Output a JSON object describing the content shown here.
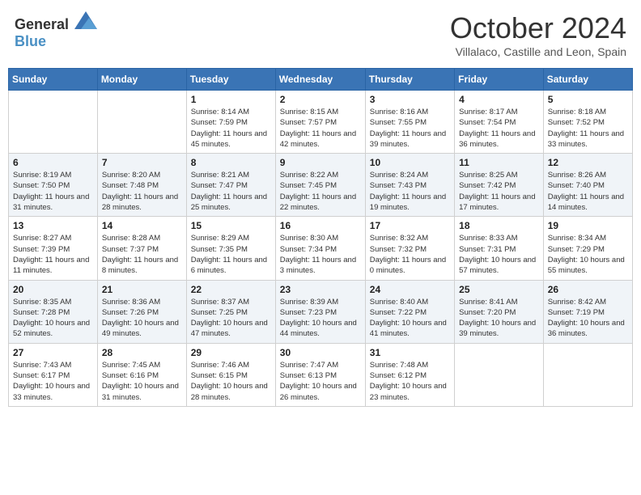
{
  "header": {
    "logo_general": "General",
    "logo_blue": "Blue",
    "month": "October 2024",
    "location": "Villalaco, Castille and Leon, Spain"
  },
  "weekdays": [
    "Sunday",
    "Monday",
    "Tuesday",
    "Wednesday",
    "Thursday",
    "Friday",
    "Saturday"
  ],
  "weeks": [
    [
      {
        "day": "",
        "info": ""
      },
      {
        "day": "",
        "info": ""
      },
      {
        "day": "1",
        "info": "Sunrise: 8:14 AM\nSunset: 7:59 PM\nDaylight: 11 hours and 45 minutes."
      },
      {
        "day": "2",
        "info": "Sunrise: 8:15 AM\nSunset: 7:57 PM\nDaylight: 11 hours and 42 minutes."
      },
      {
        "day": "3",
        "info": "Sunrise: 8:16 AM\nSunset: 7:55 PM\nDaylight: 11 hours and 39 minutes."
      },
      {
        "day": "4",
        "info": "Sunrise: 8:17 AM\nSunset: 7:54 PM\nDaylight: 11 hours and 36 minutes."
      },
      {
        "day": "5",
        "info": "Sunrise: 8:18 AM\nSunset: 7:52 PM\nDaylight: 11 hours and 33 minutes."
      }
    ],
    [
      {
        "day": "6",
        "info": "Sunrise: 8:19 AM\nSunset: 7:50 PM\nDaylight: 11 hours and 31 minutes."
      },
      {
        "day": "7",
        "info": "Sunrise: 8:20 AM\nSunset: 7:48 PM\nDaylight: 11 hours and 28 minutes."
      },
      {
        "day": "8",
        "info": "Sunrise: 8:21 AM\nSunset: 7:47 PM\nDaylight: 11 hours and 25 minutes."
      },
      {
        "day": "9",
        "info": "Sunrise: 8:22 AM\nSunset: 7:45 PM\nDaylight: 11 hours and 22 minutes."
      },
      {
        "day": "10",
        "info": "Sunrise: 8:24 AM\nSunset: 7:43 PM\nDaylight: 11 hours and 19 minutes."
      },
      {
        "day": "11",
        "info": "Sunrise: 8:25 AM\nSunset: 7:42 PM\nDaylight: 11 hours and 17 minutes."
      },
      {
        "day": "12",
        "info": "Sunrise: 8:26 AM\nSunset: 7:40 PM\nDaylight: 11 hours and 14 minutes."
      }
    ],
    [
      {
        "day": "13",
        "info": "Sunrise: 8:27 AM\nSunset: 7:39 PM\nDaylight: 11 hours and 11 minutes."
      },
      {
        "day": "14",
        "info": "Sunrise: 8:28 AM\nSunset: 7:37 PM\nDaylight: 11 hours and 8 minutes."
      },
      {
        "day": "15",
        "info": "Sunrise: 8:29 AM\nSunset: 7:35 PM\nDaylight: 11 hours and 6 minutes."
      },
      {
        "day": "16",
        "info": "Sunrise: 8:30 AM\nSunset: 7:34 PM\nDaylight: 11 hours and 3 minutes."
      },
      {
        "day": "17",
        "info": "Sunrise: 8:32 AM\nSunset: 7:32 PM\nDaylight: 11 hours and 0 minutes."
      },
      {
        "day": "18",
        "info": "Sunrise: 8:33 AM\nSunset: 7:31 PM\nDaylight: 10 hours and 57 minutes."
      },
      {
        "day": "19",
        "info": "Sunrise: 8:34 AM\nSunset: 7:29 PM\nDaylight: 10 hours and 55 minutes."
      }
    ],
    [
      {
        "day": "20",
        "info": "Sunrise: 8:35 AM\nSunset: 7:28 PM\nDaylight: 10 hours and 52 minutes."
      },
      {
        "day": "21",
        "info": "Sunrise: 8:36 AM\nSunset: 7:26 PM\nDaylight: 10 hours and 49 minutes."
      },
      {
        "day": "22",
        "info": "Sunrise: 8:37 AM\nSunset: 7:25 PM\nDaylight: 10 hours and 47 minutes."
      },
      {
        "day": "23",
        "info": "Sunrise: 8:39 AM\nSunset: 7:23 PM\nDaylight: 10 hours and 44 minutes."
      },
      {
        "day": "24",
        "info": "Sunrise: 8:40 AM\nSunset: 7:22 PM\nDaylight: 10 hours and 41 minutes."
      },
      {
        "day": "25",
        "info": "Sunrise: 8:41 AM\nSunset: 7:20 PM\nDaylight: 10 hours and 39 minutes."
      },
      {
        "day": "26",
        "info": "Sunrise: 8:42 AM\nSunset: 7:19 PM\nDaylight: 10 hours and 36 minutes."
      }
    ],
    [
      {
        "day": "27",
        "info": "Sunrise: 7:43 AM\nSunset: 6:17 PM\nDaylight: 10 hours and 33 minutes."
      },
      {
        "day": "28",
        "info": "Sunrise: 7:45 AM\nSunset: 6:16 PM\nDaylight: 10 hours and 31 minutes."
      },
      {
        "day": "29",
        "info": "Sunrise: 7:46 AM\nSunset: 6:15 PM\nDaylight: 10 hours and 28 minutes."
      },
      {
        "day": "30",
        "info": "Sunrise: 7:47 AM\nSunset: 6:13 PM\nDaylight: 10 hours and 26 minutes."
      },
      {
        "day": "31",
        "info": "Sunrise: 7:48 AM\nSunset: 6:12 PM\nDaylight: 10 hours and 23 minutes."
      },
      {
        "day": "",
        "info": ""
      },
      {
        "day": "",
        "info": ""
      }
    ]
  ]
}
